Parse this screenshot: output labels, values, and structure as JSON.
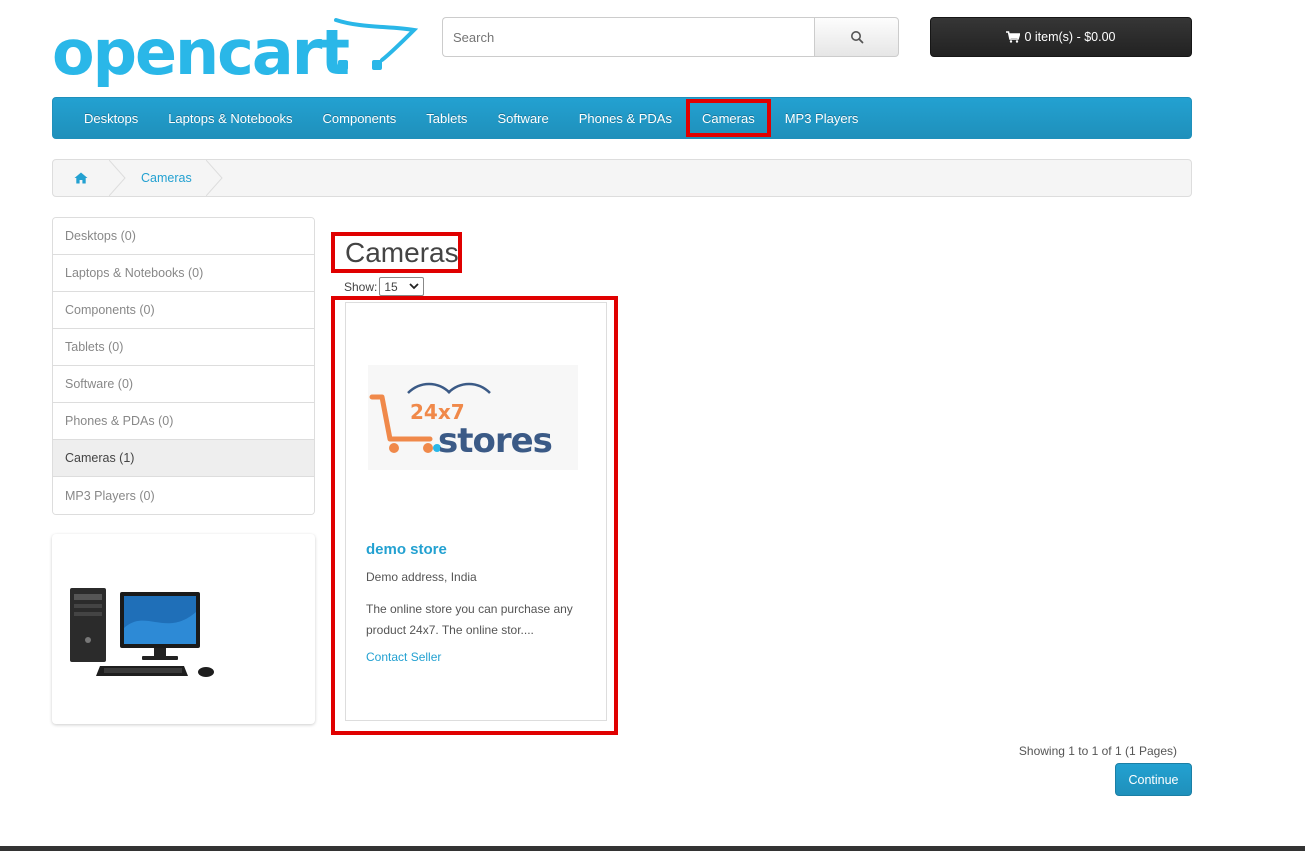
{
  "header": {
    "logo_text": "opencart",
    "search": {
      "placeholder": "Search",
      "value": ""
    },
    "search_icon": "search-icon",
    "cart": {
      "label": "0 item(s) - $0.00",
      "icon": "shopping-cart-icon"
    }
  },
  "nav": {
    "items": [
      {
        "label": "Desktops"
      },
      {
        "label": "Laptops & Notebooks"
      },
      {
        "label": "Components"
      },
      {
        "label": "Tablets"
      },
      {
        "label": "Software"
      },
      {
        "label": "Phones & PDAs"
      },
      {
        "label": "Cameras",
        "active": true
      },
      {
        "label": "MP3 Players"
      }
    ]
  },
  "breadcrumb": {
    "home_icon": "home-icon",
    "items": [
      {
        "label": "Cameras"
      }
    ]
  },
  "sidebar": {
    "items": [
      {
        "label": "Desktops (0)"
      },
      {
        "label": "Laptops & Notebooks (0)"
      },
      {
        "label": "Components (0)"
      },
      {
        "label": "Tablets (0)"
      },
      {
        "label": "Software (0)"
      },
      {
        "label": "Phones & PDAs (0)"
      },
      {
        "label": "Cameras (1)",
        "active": true
      },
      {
        "label": "MP3 Players (0)"
      }
    ]
  },
  "main": {
    "title": "Cameras",
    "show_label": "Show:",
    "show_value": "15",
    "seller_card": {
      "logo_text_top": "24x7",
      "logo_text_main": "stores",
      "name": "demo store",
      "address": "Demo address, India",
      "description": "The online store you can purchase any product 24x7. The online stor....",
      "contact_label": "Contact Seller"
    },
    "results_text": "Showing 1 to 1 of 1 (1 Pages)",
    "continue_label": "Continue"
  },
  "colors": {
    "brand_blue": "#23a1d1",
    "highlight_red": "#e00000",
    "logo_blue": "#2ab7e8",
    "cart_dark": "#2a2a2a",
    "stores_orange": "#f0894a",
    "stores_navy": "#3b5a86"
  }
}
